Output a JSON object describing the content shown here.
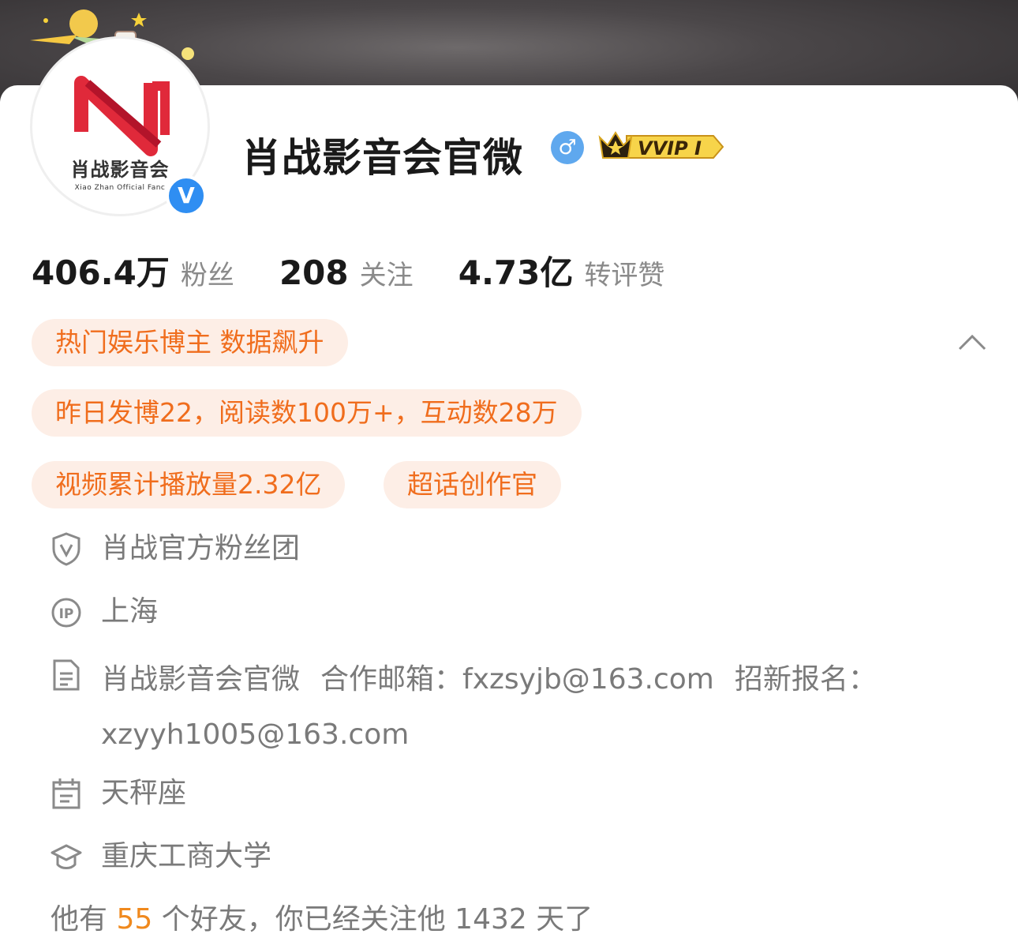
{
  "profile": {
    "name": "肖战影音会官微",
    "avatar_text": "肖战影音会",
    "avatar_subtext": "Xiao Zhan Official Fanc",
    "verified_mark": "V",
    "gender_symbol": "♂",
    "vip_label": "VVIP I"
  },
  "stats": [
    {
      "value": "406.4万",
      "label": "粉丝"
    },
    {
      "value": "208",
      "label": "关注"
    },
    {
      "value": "4.73亿",
      "label": "转评赞"
    }
  ],
  "tags": {
    "hot": "热门娱乐博主 数据飙升",
    "daily": "昨日发博22，阅读数100万+，互动数28万",
    "video": "视频累计播放量2.32亿",
    "creator": "超话创作官"
  },
  "info": {
    "fan_group": "肖战官方粉丝团",
    "ip_location": "上海",
    "description_name": "肖战影音会官微",
    "description_coop": "合作邮箱：fxzsyjb@163.com",
    "description_recruit": "招新报名：xzyyh1005@163.com",
    "constellation": "天秤座",
    "school": "重庆工商大学"
  },
  "friends": {
    "prefix": "他有",
    "count": "55",
    "suffix": "个好友，你已经关注他 1432 天了"
  },
  "colors": {
    "accent_orange": "#f06d1d",
    "tag_bg": "#fdeee6",
    "verified_blue": "#2f8ef2",
    "gender_blue": "#5fa8ee",
    "vip_gold": "#f5c518"
  }
}
